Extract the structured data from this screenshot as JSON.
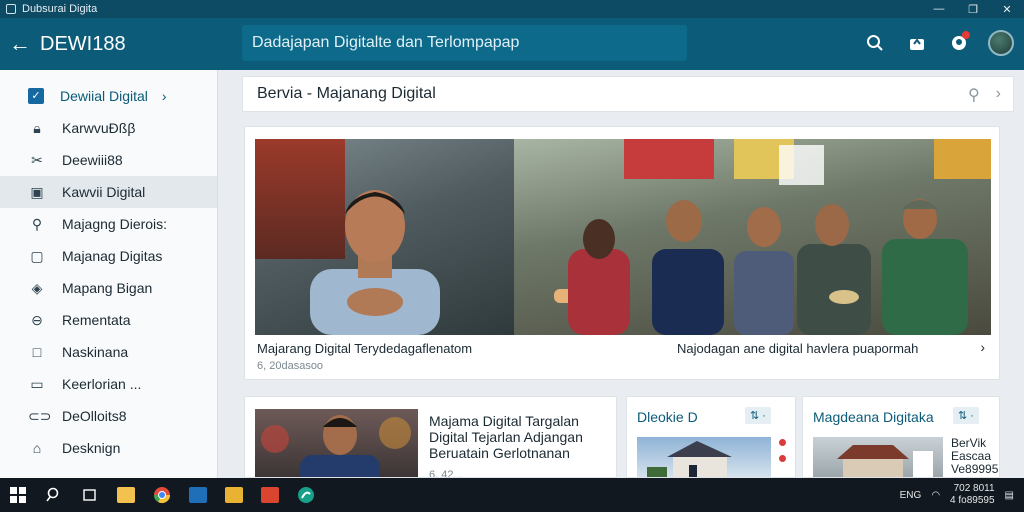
{
  "window": {
    "title": "Dubsurai Digita",
    "minimize": "—",
    "maximize": "❐",
    "close": "✕"
  },
  "header": {
    "brand": "DEWI188",
    "search_value": "Dadajapan Digitalte dan Terlompapap",
    "icons": [
      "search-icon",
      "share-icon",
      "notifications-icon",
      "avatar"
    ]
  },
  "sidebar": {
    "items": [
      {
        "label": "Dewiial Digital",
        "icon": "checkbox-icon"
      },
      {
        "label": "KarwvuĐßβ",
        "icon": "lock-icon"
      },
      {
        "label": "Deewiii88",
        "icon": "scissors-icon"
      },
      {
        "label": "Kawvii Digital",
        "icon": "image-icon"
      },
      {
        "label": "Majagng Dierois:",
        "icon": "search-icon"
      },
      {
        "label": "Majanag Digitas",
        "icon": "comment-icon"
      },
      {
        "label": "Mapang Bigan",
        "icon": "compass-icon"
      },
      {
        "label": "Rementata",
        "icon": "minus-circle-icon"
      },
      {
        "label": "Naskinana",
        "icon": "square-icon"
      },
      {
        "label": "Keerlorian ...",
        "icon": "card-icon"
      },
      {
        "label": "DeOlloits8",
        "icon": "toggle-icon"
      },
      {
        "label": "Desknign",
        "icon": "bag-icon"
      }
    ]
  },
  "crumb": {
    "text": "Bervia - Majanang Digital"
  },
  "feature": {
    "caption_left": "Majarang Digital Terydedagaflenatom",
    "caption_right": "Najodagan ane digital havlera puapormah",
    "meta": "6, 20dasasoo"
  },
  "cards": [
    {
      "title_lines": [
        "Majama Digital Targalan",
        "Digital Tejarlan Adjangan",
        "Beruatain Gerlotnanan"
      ],
      "meta": "6, 42..."
    },
    {
      "title": "Dleokie D",
      "badge": "⇅ ·"
    },
    {
      "title": "Magdeana Digitaka",
      "badge": "⇅ ·",
      "side": [
        "BerVik",
        "Eascaa",
        "Ve89995"
      ]
    }
  ],
  "taskbar": {
    "apps": [
      "start-icon",
      "search-icon",
      "task-view-icon",
      "folder-icon",
      "chrome-icon",
      "store-icon",
      "files-icon",
      "office-icon",
      "edge-icon"
    ],
    "clock_time": "702 8011",
    "clock_date": "4 fo89595",
    "tray_label": "ENG"
  }
}
